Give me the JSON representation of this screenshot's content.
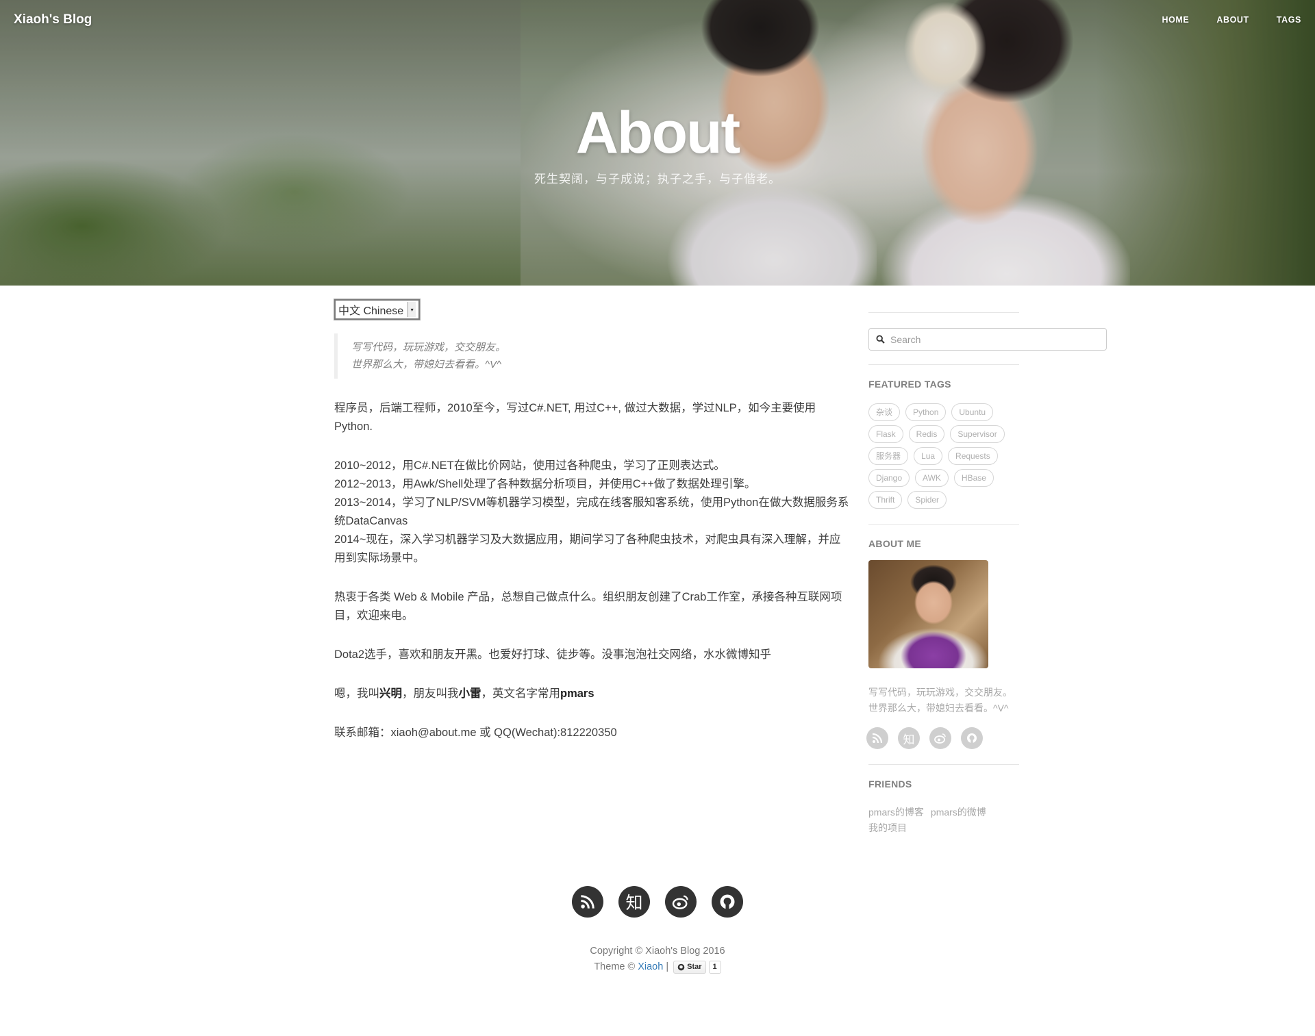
{
  "nav": {
    "brand": "Xiaoh's Blog",
    "links": [
      "HOME",
      "ABOUT",
      "TAGS"
    ]
  },
  "hero": {
    "title": "About",
    "subtitle": "死生契阔，与子成说；执子之手，与子偕老。"
  },
  "main": {
    "language_select": "中文 Chinese",
    "quote_lines": [
      "写写代码，玩玩游戏，交交朋友。",
      "世界那么大，带媳妇去看看。^V^"
    ],
    "intro": "程序员，后端工程师，2010至今，写过C#.NET, 用过C++, 做过大数据，学过NLP，如今主要使用Python.",
    "timeline": [
      "2010~2012，用C#.NET在做比价网站，使用过各种爬虫，学习了正则表达式。",
      "2012~2013，用Awk/Shell处理了各种数据分析项目，并使用C++做了数据处理引擎。",
      "2013~2014，学习了NLP/SVM等机器学习模型，完成在线客服知客系统，使用Python在做大数据服务系统DataCanvas",
      "2014~现在，深入学习机器学习及大数据应用，期间学习了各种爬虫技术，对爬虫具有深入理解，并应用到实际场景中。"
    ],
    "hobby_web": "热衷于各类 Web & Mobile 产品，总想自己做点什么。组织朋友创建了Crab工作室，承接各种互联网项目，欢迎来电。",
    "hobby_game": "Dota2选手，喜欢和朋友开黑。也爱好打球、徒步等。没事泡泡社交网络，水水微博知乎",
    "name_line": {
      "prefix": "嗯，我叫",
      "name": "兴明",
      "mid": "，朋友叫我",
      "nickname": "小雷",
      "mid2": "，英文名字常用",
      "english": "pmars"
    },
    "contact": "联系邮箱：xiaoh@about.me 或 QQ(Wechat):812220350"
  },
  "sidebar": {
    "search_placeholder": "Search",
    "featured_tags_title": "FEATURED TAGS",
    "tags": [
      "杂谈",
      "Python",
      "Ubuntu",
      "Flask",
      "Redis",
      "Supervisor",
      "服务器",
      "Lua",
      "Requests",
      "Django",
      "AWK",
      "HBase",
      "Thrift",
      "Spider"
    ],
    "about_me_title": "ABOUT ME",
    "about_lines": [
      "写写代码，玩玩游戏，交交朋友。",
      "世界那么大，带媳妇去看看。^V^"
    ],
    "social_icons": [
      "rss-icon",
      "zhihu-icon",
      "weibo-icon",
      "github-icon"
    ],
    "zhihu_glyph": "知",
    "friends_title": "FRIENDS",
    "friends": [
      "pmars的博客",
      "pmars的微博",
      "我的项目"
    ]
  },
  "footer": {
    "zhihu_glyph": "知",
    "copyright": "Copyright © Xiaoh's Blog 2016",
    "theme_prefix": "Theme © ",
    "theme_author": "Xiaoh",
    "separator": " |",
    "star_label": "Star",
    "star_count": "1"
  }
}
